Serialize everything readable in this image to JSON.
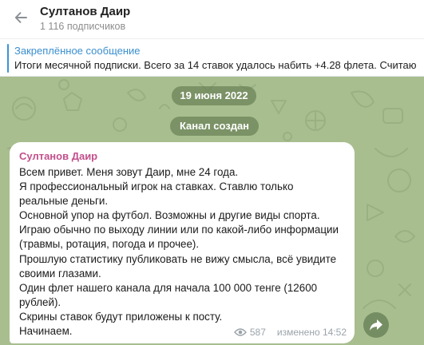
{
  "header": {
    "back_icon": "arrow-left-icon",
    "title": "Султанов Даир",
    "subtitle": "1 116 подписчиков"
  },
  "pinned": {
    "label": "Закреплённое сообщение",
    "text": "Итоги месячной подписки. Всего за 14 ставок удалось набить +4.28 флета. Считаю"
  },
  "chat": {
    "date": "19 июня 2022",
    "channel_created": "Канал создан",
    "background_color": "#a8be8f"
  },
  "message": {
    "author": "Султанов Даир",
    "author_color": "#c2508c",
    "text": "Всем привет. Меня зовут Даир, мне 24 года.\nЯ профессиональный игрок на ставках. Ставлю только реальные деньги.\nОсновной упор на футбол. Возможны и другие виды спорта.\nИграю обычно по выходу линии или по какой-либо информации (травмы, ротация, погода и прочее).\nПрошлую статистику публиковать не вижу смысла, всё увидите своими глазами.\nОдин флет нашего канала для начала 100 000 тенге (12600 рублей).\nСкрины ставок будут приложены к посту.\nНачинаем.",
    "views": "587",
    "edited_time": "изменено 14:52",
    "views_icon": "eye-icon"
  },
  "share": {
    "icon": "share-arrow-icon"
  }
}
